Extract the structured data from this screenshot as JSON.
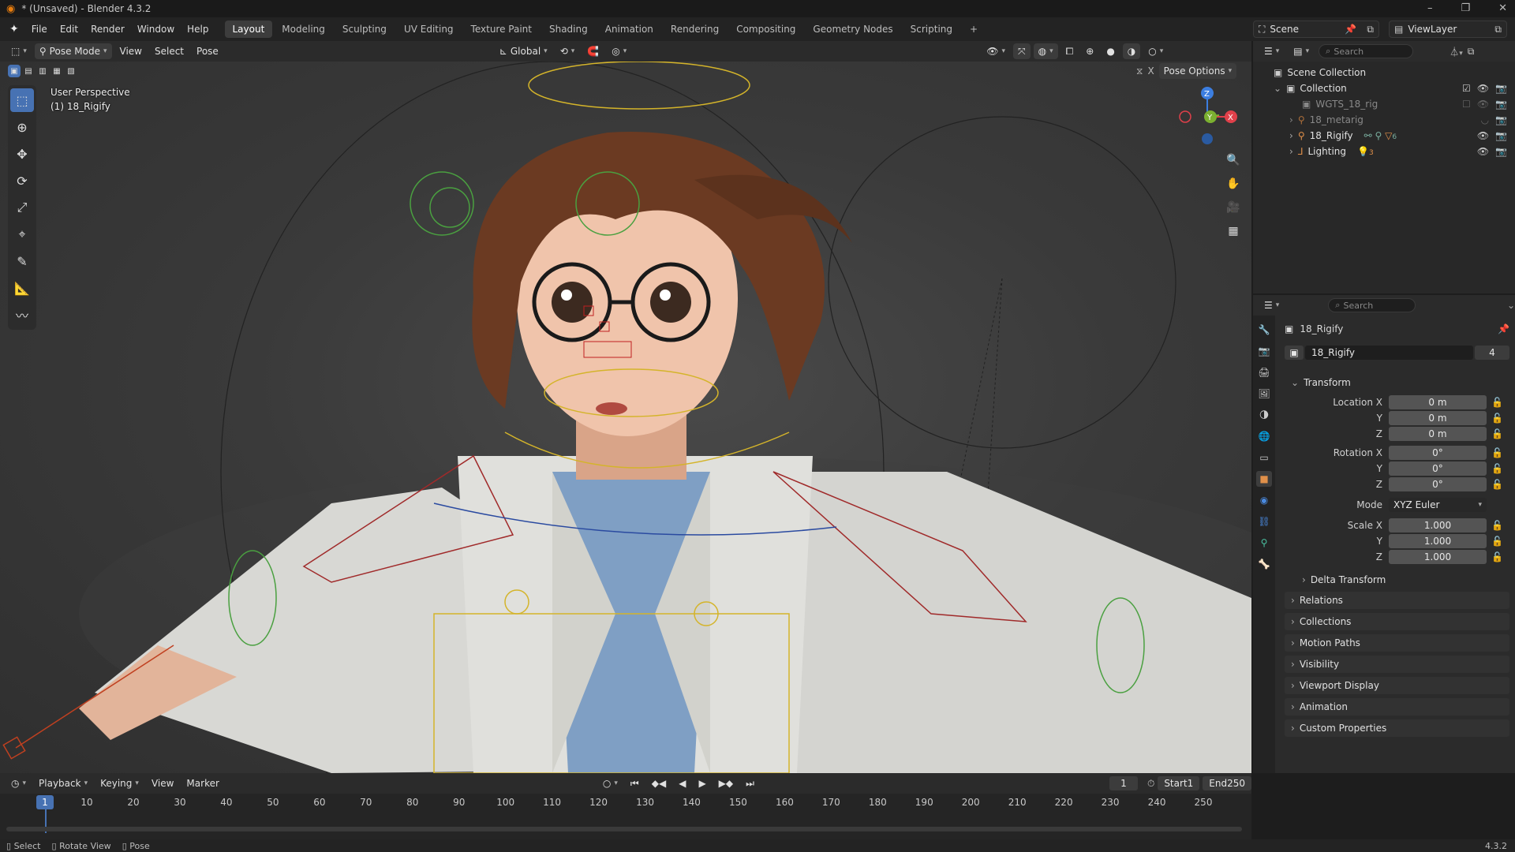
{
  "window": {
    "title": "* (Unsaved) - Blender 4.3.2"
  },
  "menu": {
    "items": [
      "File",
      "Edit",
      "Render",
      "Window",
      "Help"
    ]
  },
  "workspaces": {
    "tabs": [
      "Layout",
      "Modeling",
      "Sculpting",
      "UV Editing",
      "Texture Paint",
      "Shading",
      "Animation",
      "Rendering",
      "Compositing",
      "Geometry Nodes",
      "Scripting"
    ],
    "active": "Layout",
    "add": "+"
  },
  "scene": {
    "label": "Scene",
    "viewlayer": "ViewLayer"
  },
  "viewport_header": {
    "mode": "Pose Mode",
    "menus": [
      "View",
      "Select",
      "Pose"
    ],
    "orientation": "Global",
    "pose_options": "Pose Options"
  },
  "viewport": {
    "perspective": "User Perspective",
    "object": "(1) 18_Rigify",
    "gizmo": {
      "x": "X",
      "y": "Y",
      "z": "Z"
    }
  },
  "outliner": {
    "search_placeholder": "Search",
    "rows": [
      {
        "label": "Scene Collection"
      },
      {
        "label": "Collection"
      },
      {
        "label": "WGTS_18_rig"
      },
      {
        "label": "18_metarig"
      },
      {
        "label": "18_Rigify"
      },
      {
        "label": "Lighting"
      }
    ],
    "badge_rigify": "6",
    "badge_lighting": "3"
  },
  "properties": {
    "search_placeholder": "Search",
    "object_name": "18_Rigify",
    "datablock_name": "18_Rigify",
    "users": "4",
    "transform_label": "Transform",
    "location": {
      "label": "Location X",
      "y_label": "Y",
      "z_label": "Z",
      "x": "0 m",
      "y": "0 m",
      "z": "0 m"
    },
    "rotation": {
      "label": "Rotation X",
      "y_label": "Y",
      "z_label": "Z",
      "x": "0°",
      "y": "0°",
      "z": "0°"
    },
    "mode": {
      "label": "Mode",
      "value": "XYZ Euler"
    },
    "scale": {
      "label": "Scale X",
      "y_label": "Y",
      "z_label": "Z",
      "x": "1.000",
      "y": "1.000",
      "z": "1.000"
    },
    "delta": "Delta Transform",
    "panels": [
      "Relations",
      "Collections",
      "Motion Paths",
      "Visibility",
      "Viewport Display",
      "Animation",
      "Custom Properties"
    ]
  },
  "timeline": {
    "menus": [
      "Playback",
      "Keying",
      "View",
      "Marker"
    ],
    "current_frame": "1",
    "start_label": "Start",
    "start": "1",
    "end_label": "End",
    "end": "250",
    "ruler": [
      "10",
      "20",
      "30",
      "40",
      "50",
      "60",
      "70",
      "80",
      "90",
      "100",
      "110",
      "120",
      "130",
      "140",
      "150",
      "160",
      "170",
      "180",
      "190",
      "200",
      "210",
      "220",
      "230",
      "240",
      "250"
    ],
    "playhead": "1"
  },
  "statusbar": {
    "items": [
      "Select",
      "Rotate View",
      "Pose"
    ],
    "version": "4.3.2"
  },
  "colors": {
    "accent": "#4772b3",
    "header": "#2b2b2b",
    "viewport": "#3a3a3a",
    "x_axis": "#e0404a",
    "y_axis": "#7bb030",
    "z_axis": "#3c7ee0"
  }
}
